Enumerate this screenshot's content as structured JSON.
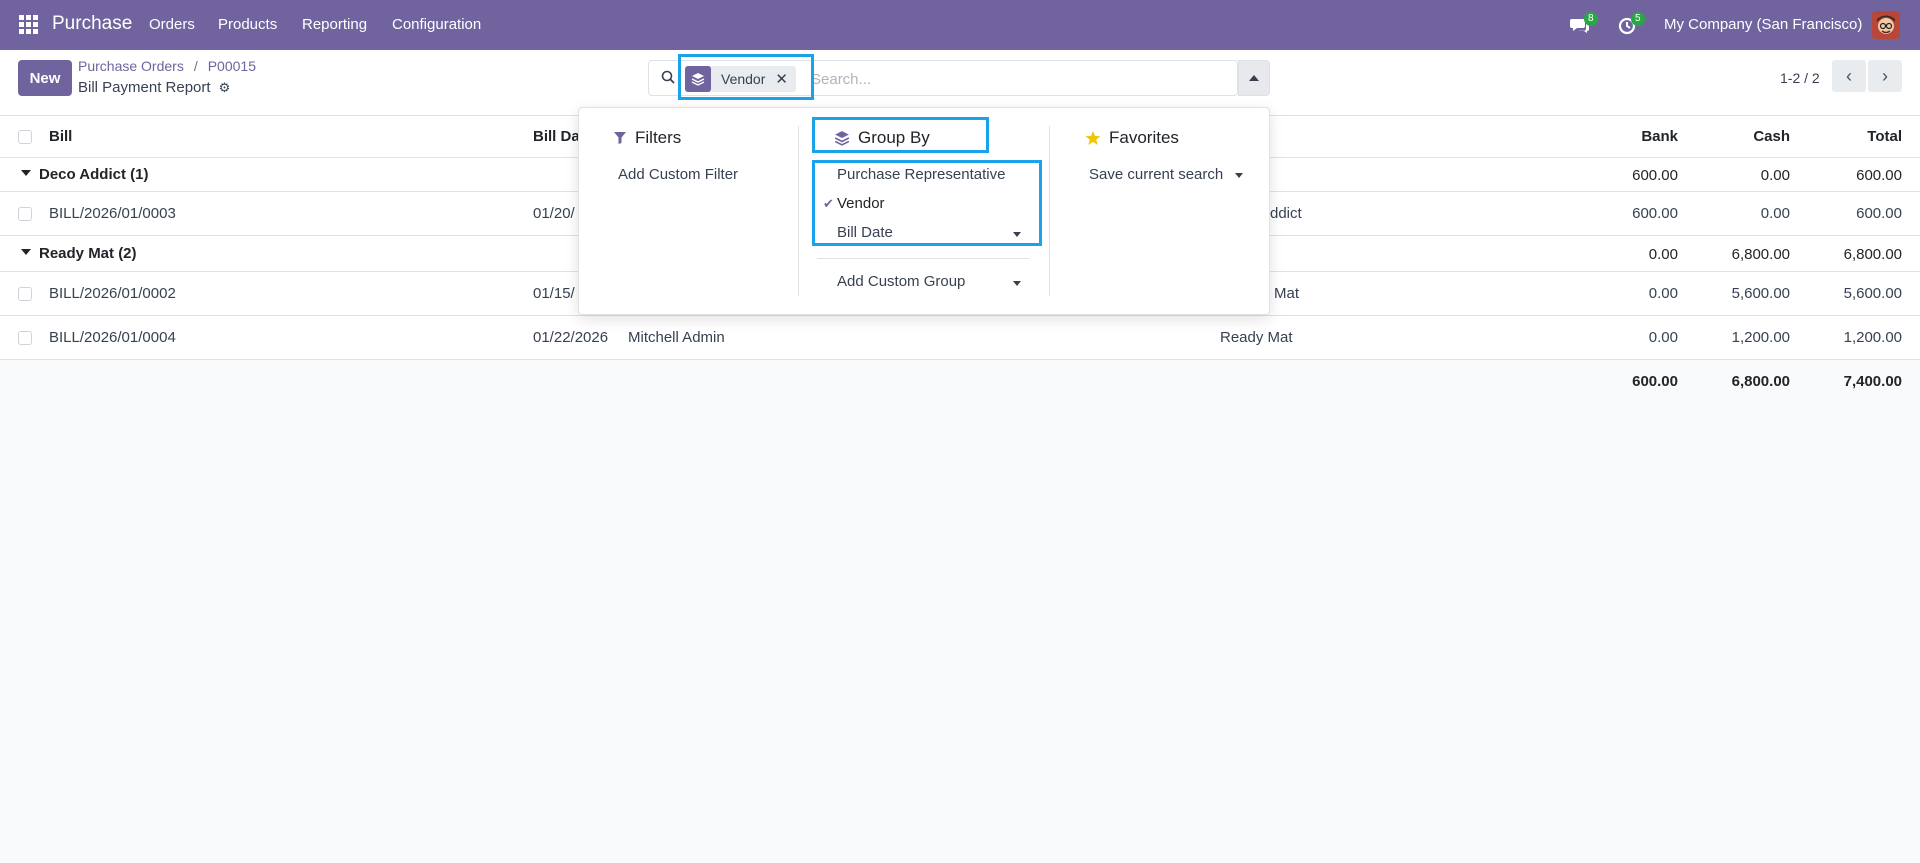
{
  "navbar": {
    "app_name": "Purchase",
    "menu": [
      "Orders",
      "Products",
      "Reporting",
      "Configuration"
    ],
    "messages_count": "8",
    "activities_count": "5",
    "company": "My Company (San Francisco)",
    "color": "#71639e"
  },
  "control": {
    "new_label": "New",
    "breadcrumb": [
      "Purchase Orders",
      "P00015"
    ],
    "subtitle": "Bill Payment Report",
    "pager": "1-2 / 2"
  },
  "search": {
    "facet_label": "Vendor",
    "placeholder": "Search..."
  },
  "dropdown": {
    "filters": {
      "title": "Filters",
      "items": [
        "Add Custom Filter"
      ]
    },
    "group_by": {
      "title": "Group By",
      "items": [
        "Purchase Representative",
        "Vendor",
        "Bill Date"
      ],
      "selected": "Vendor",
      "add_custom": "Add Custom Group"
    },
    "favorites": {
      "title": "Favorites",
      "items": [
        "Save current search"
      ]
    }
  },
  "table": {
    "headers": {
      "bill": "Bill",
      "bill_date": "Bill Da",
      "bank": "Bank",
      "cash": "Cash",
      "total": "Total"
    },
    "groups": [
      {
        "label": "Deco Addict (1)",
        "bank": "600.00",
        "cash": "0.00",
        "total": "600.00",
        "rows": [
          {
            "bill": "BILL/2026/01/0003",
            "date": "01/20/",
            "rep": "",
            "vendor": "ddict",
            "bank": "600.00",
            "cash": "0.00",
            "total": "600.00"
          }
        ]
      },
      {
        "label": "Ready Mat (2)",
        "bank": "0.00",
        "cash": "6,800.00",
        "total": "6,800.00",
        "rows": [
          {
            "bill": "BILL/2026/01/0002",
            "date": "01/15/",
            "rep": "",
            "vendor": "Mat",
            "bank": "0.00",
            "cash": "5,600.00",
            "total": "5,600.00"
          },
          {
            "bill": "BILL/2026/01/0004",
            "date": "01/22/2026",
            "rep": "Mitchell Admin",
            "vendor": "Ready Mat",
            "bank": "0.00",
            "cash": "1,200.00",
            "total": "1,200.00"
          }
        ]
      }
    ],
    "totals": {
      "bank": "600.00",
      "cash": "6,800.00",
      "total": "7,400.00"
    }
  }
}
